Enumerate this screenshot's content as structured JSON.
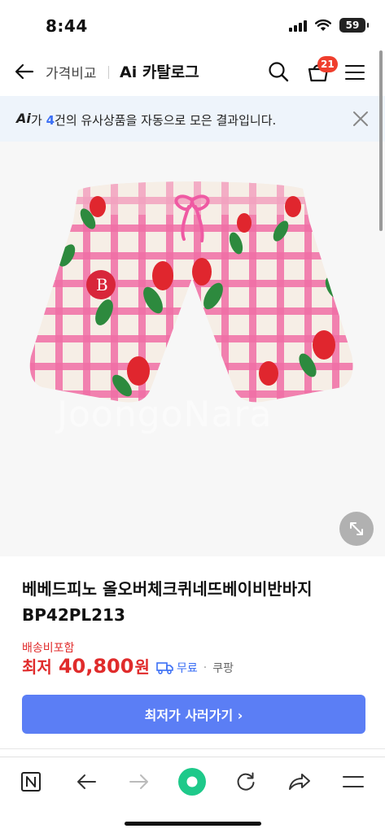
{
  "status_bar": {
    "time": "8:44",
    "battery": "59"
  },
  "header": {
    "crumb": "가격비교",
    "catalog_title": "Ai 카탈로그",
    "cart_count": "21"
  },
  "banner": {
    "ai_logo": "Ai",
    "text_before": "가 ",
    "count": "4",
    "text_after": "건의 유사상품을 자동으로 모은 결과입니다."
  },
  "product_image": {
    "watermark": "JoongoNara"
  },
  "product": {
    "name": "베베드피노 올오버체크퀴네뜨베이비반바지 BP42PL213",
    "shipping_included": "배송비포함",
    "price_prefix": "최저",
    "price": "40,800",
    "price_unit": "원",
    "shipping_text": "무료",
    "separator": "·",
    "seller": "쿠팡"
  },
  "buy_button": {
    "label": "최저가 사러가기 ›"
  },
  "colors": {
    "accent_blue": "#5b7ef5",
    "price_red": "#e02b2b",
    "badge_red": "#ef3e2d",
    "banner_bg": "#eef4fb",
    "toolbar_green": "#1ec98a"
  },
  "toolbar": {
    "items": [
      "n-logo-icon",
      "back-arrow-icon",
      "forward-arrow-icon",
      "home-green-icon",
      "refresh-icon",
      "share-icon",
      "menu-icon"
    ]
  }
}
